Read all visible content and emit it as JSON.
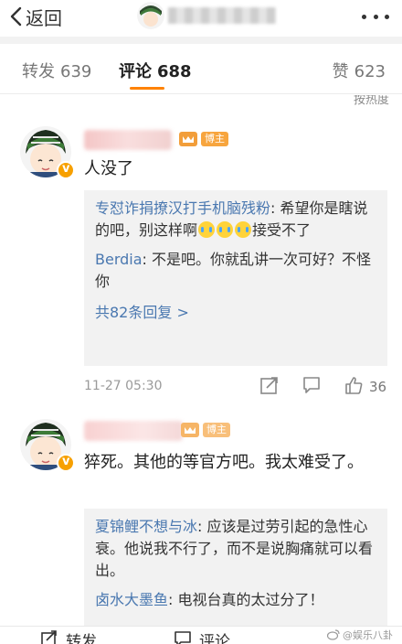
{
  "header": {
    "back_label": "返回"
  },
  "tabs": {
    "repost_label": "转发",
    "repost_count": "639",
    "comment_label": "评论",
    "comment_count": "688",
    "like_label": "赞",
    "like_count": "623"
  },
  "sort_hint": "按热度",
  "comments": [
    {
      "badge_label": "博主",
      "text": "人没了",
      "replies": [
        {
          "name": "专怼诈捐撩汉打手机脑残粉",
          "text": "希望你是瞎说的吧，别这样啊",
          "text_after": "接受不了"
        },
        {
          "name": "Berdia",
          "text": "不是吧。你就乱讲一次可好？不怪你"
        }
      ],
      "more_replies": "共82条回复 >",
      "timestamp": "11-27 05:30",
      "like_count": "36"
    },
    {
      "badge_label": "博主",
      "text": "猝死。其他的等官方吧。我太难受了。",
      "replies": [
        {
          "name": "夏锦鲤不想与冰",
          "text": "应该是过劳引起的急性心衰。他说我不行了，而不是说胸痛就可以看出。"
        },
        {
          "name": "卤水大墨鱼",
          "text": "电视台真的太过分了！"
        }
      ]
    }
  ],
  "bottom_bar": {
    "repost_label": "转发",
    "comment_label": "评论"
  },
  "watermark": "@娱乐八卦",
  "colors": {
    "accent": "#ff8200",
    "link": "#4a78b0",
    "reply_bg": "#f2f2f2"
  }
}
